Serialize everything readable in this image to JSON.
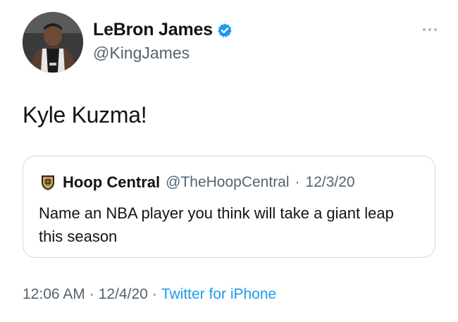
{
  "author": {
    "display_name": "LeBron James",
    "handle": "@KingJames",
    "verified": true,
    "avatar_icon": "user-avatar",
    "verified_icon": "verified-badge-icon"
  },
  "tweet": {
    "text": "Kyle Kuzma!",
    "time": "12:06 AM",
    "separator": "·",
    "date": "12/4/20",
    "source": "Twitter for iPhone"
  },
  "quote": {
    "logo_icon": "hoop-central-logo-icon",
    "name": "Hoop Central",
    "handle": "@TheHoopCentral",
    "separator": "·",
    "date": "12/3/20",
    "text": "Name an NBA player you think will take a giant leap this season"
  },
  "colors": {
    "accent": "#1d9bf0",
    "secondary_text": "#536471",
    "border": "#cfd9de"
  }
}
